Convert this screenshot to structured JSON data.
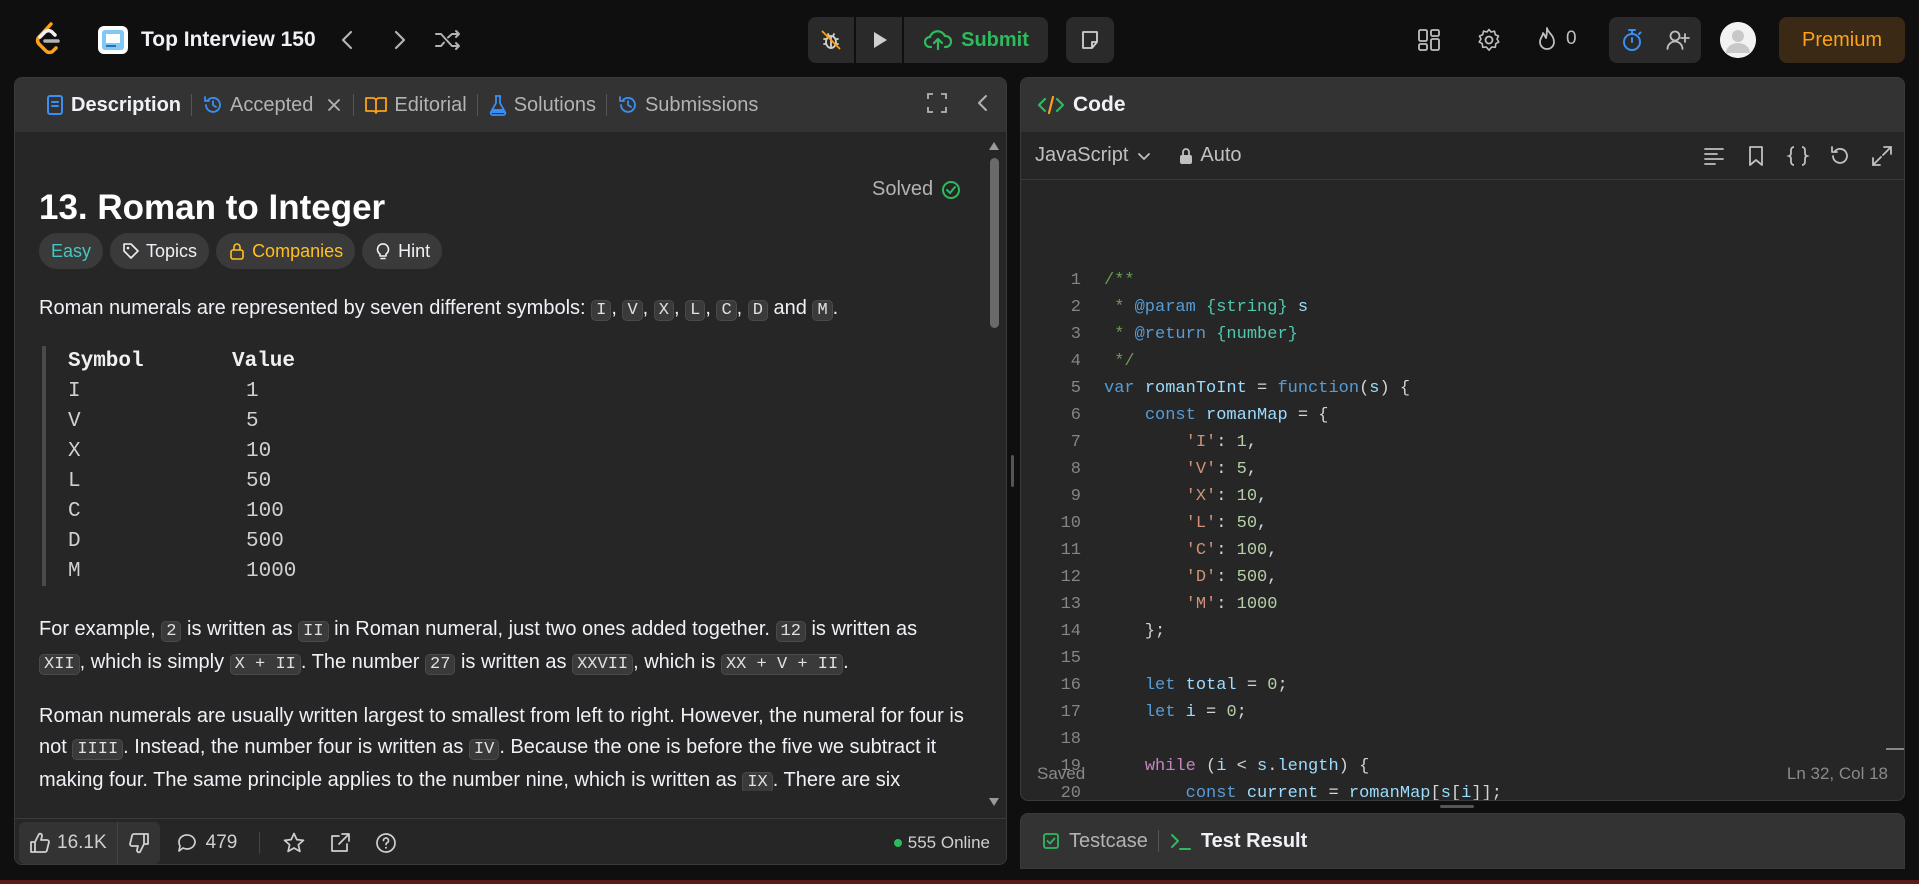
{
  "topbar": {
    "list_title": "Top Interview 150",
    "submit_label": "Submit",
    "streak_count": "0",
    "premium_label": "Premium"
  },
  "left_tabs": [
    {
      "label": "Description",
      "icon": "description-icon"
    },
    {
      "label": "Accepted",
      "icon": "history-icon"
    },
    {
      "label": "Editorial",
      "icon": "book-icon"
    },
    {
      "label": "Solutions",
      "icon": "flask-icon"
    },
    {
      "label": "Submissions",
      "icon": "history-icon"
    }
  ],
  "problem": {
    "title": "13. Roman to Integer",
    "status": "Solved",
    "chips": {
      "difficulty": "Easy",
      "topics": "Topics",
      "companies": "Companies",
      "hint": "Hint"
    },
    "intro": "Roman numerals are represented by seven different symbols:",
    "symbols": [
      "I",
      "V",
      "X",
      "L",
      "C",
      "D",
      "M"
    ],
    "table_header": {
      "col1": "Symbol",
      "col2": "Value"
    },
    "table_rows": [
      {
        "symbol": "I",
        "value": "1"
      },
      {
        "symbol": "V",
        "value": "5"
      },
      {
        "symbol": "X",
        "value": "10"
      },
      {
        "symbol": "L",
        "value": "50"
      },
      {
        "symbol": "C",
        "value": "100"
      },
      {
        "symbol": "D",
        "value": "500"
      },
      {
        "symbol": "M",
        "value": "1000"
      }
    ],
    "example_para": {
      "t1": "For example, ",
      "c1": "2",
      "t2": " is written as ",
      "c2": "II",
      "t3": " in Roman numeral, just two ones added together. ",
      "c3": "12",
      "t4": " is written as ",
      "c4": "XII",
      "t5": ", which is simply ",
      "c5": "X + II",
      "t6": ". The number ",
      "c6": "27",
      "t7": " is written as ",
      "c7": "XXVII",
      "t8": ", which is ",
      "c8": "XX + V + II",
      "t9": "."
    },
    "order_para": {
      "t1": "Roman numerals are usually written largest to smallest from left to right. However, the numeral for four is not ",
      "c1": "IIII",
      "t2": ". Instead, the number four is written as ",
      "c2": "IV",
      "t3": ". Because the one is before the five we subtract it making four. The same principle applies to the number nine, which is written as ",
      "c3": "IX",
      "t4": ". There are six instances where subtraction is used:"
    }
  },
  "left_bottom": {
    "likes": "16.1K",
    "comments": "479",
    "online": "555 Online"
  },
  "code": {
    "header": "Code",
    "language": "JavaScript",
    "mode": "Auto",
    "status": "Saved",
    "cursor": "Ln 32, Col 18",
    "lines": [
      {
        "n": "1"
      },
      {
        "n": "2"
      },
      {
        "n": "3"
      },
      {
        "n": "4"
      },
      {
        "n": "5"
      },
      {
        "n": "6"
      },
      {
        "n": "7"
      },
      {
        "n": "8"
      },
      {
        "n": "9"
      },
      {
        "n": "10"
      },
      {
        "n": "11"
      },
      {
        "n": "12"
      },
      {
        "n": "13"
      },
      {
        "n": "14"
      },
      {
        "n": "15"
      },
      {
        "n": "16"
      },
      {
        "n": "17"
      },
      {
        "n": "18"
      },
      {
        "n": "19"
      },
      {
        "n": "20"
      }
    ]
  },
  "test": {
    "tab1": "Testcase",
    "tab2": "Test Result"
  },
  "colors": {
    "accent_green": "#2cbb5d",
    "premium_orange": "#ffa116",
    "easy_teal": "#46c6c2",
    "companies_yellow": "#ffc01e"
  }
}
